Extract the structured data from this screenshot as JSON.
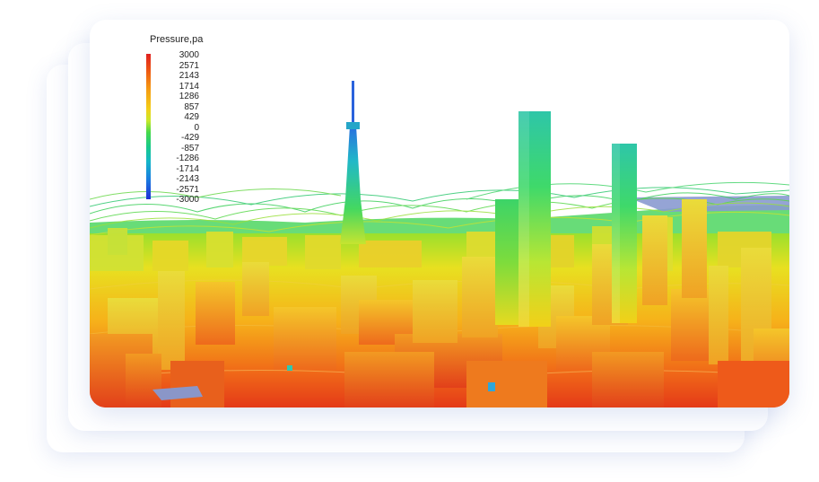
{
  "legend": {
    "title": "Pressure,pa",
    "ticks": [
      "3000",
      "2571",
      "2143",
      "1714",
      "1286",
      "857",
      "429",
      "0",
      "-429",
      "-857",
      "-1286",
      "-1714",
      "-2143",
      "-2571",
      "-3000"
    ]
  },
  "scene": {
    "subject": "city-cfd-pressure-simulation"
  }
}
